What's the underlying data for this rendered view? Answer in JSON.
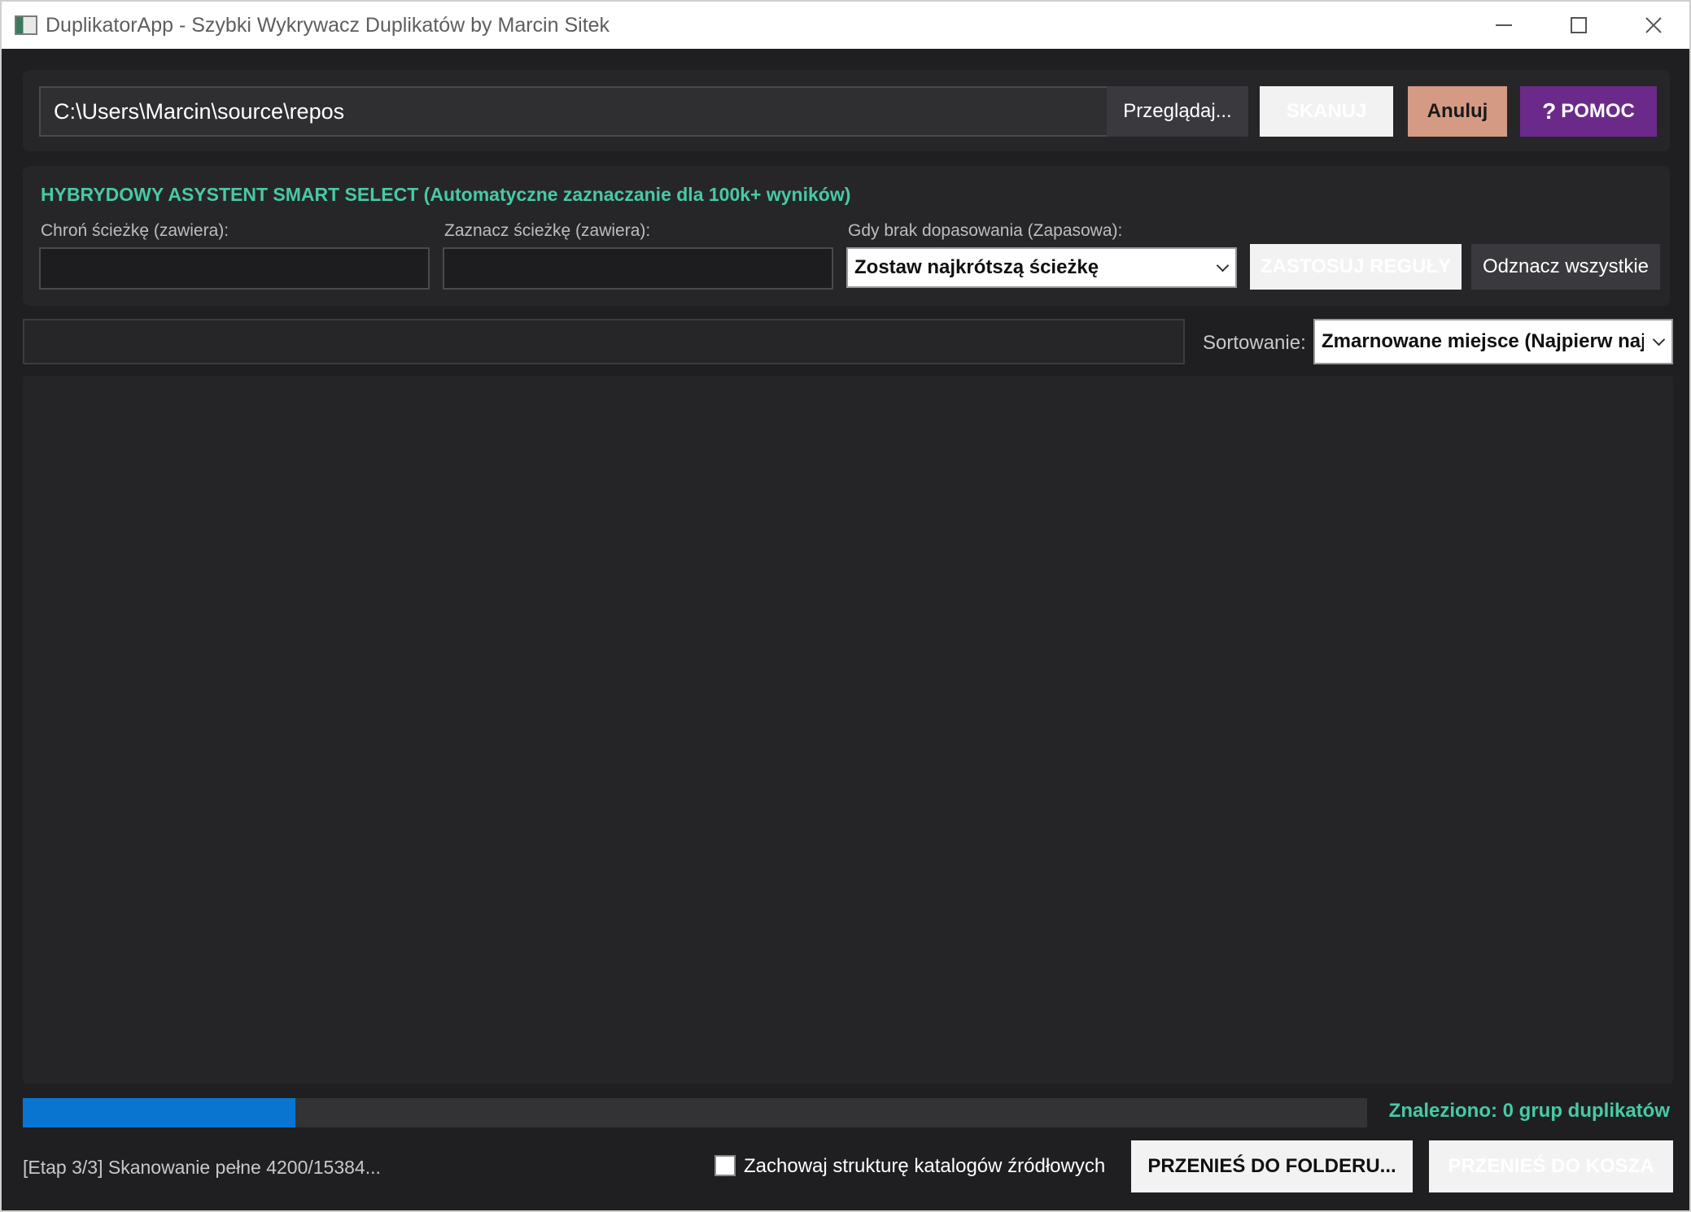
{
  "window": {
    "title": "DuplikatorApp - Szybki Wykrywacz Duplikatów by Marcin Sitek"
  },
  "toolbar": {
    "path_value": "C:\\Users\\Marcin\\source\\repos",
    "browse_label": "Przeglądaj...",
    "scan_label": "SKANUJ",
    "cancel_label": "Anuluj",
    "help_icon": "question-icon",
    "help_label": "POMOC"
  },
  "smart_select": {
    "title": "HYBRYDOWY ASYSTENT SMART SELECT (Automatyczne zaznaczanie dla 100k+ wyników)",
    "protect_label": "Chroń ścieżkę (zawiera):",
    "protect_value": "",
    "mark_label": "Zaznacz ścieżkę (zawiera):",
    "mark_value": "",
    "fallback_label": "Gdy brak dopasowania (Zapasowa):",
    "fallback_selected": "Zostaw najkrótszą ścieżkę",
    "apply_label": "ZASTOSUJ REGUŁY",
    "unmark_label": "Odznacz wszystkie"
  },
  "filter": {
    "value": ""
  },
  "sorting": {
    "label": "Sortowanie:",
    "selected": "Zmarnowane miejsce (Najpierw największe)"
  },
  "progress": {
    "fraction": 0.203,
    "found_text": "Znaleziono: 0 grup duplikatów"
  },
  "footer": {
    "status_text": "[Etap 3/3] Skanowanie pełne 4200/15384...",
    "keep_structure_label": "Zachowaj strukturę katalogów źródłowych",
    "keep_structure_checked": false,
    "move_folder_label": "PRZENIEŚ DO FOLDERU...",
    "move_trash_label": "PRZENIEŚ DO KOSZA"
  },
  "colors": {
    "accent_teal": "#48c9a6",
    "help_purple": "#6b2a8a",
    "cancel_salmon": "#d49a83",
    "progress_blue": "#0a74d1"
  }
}
